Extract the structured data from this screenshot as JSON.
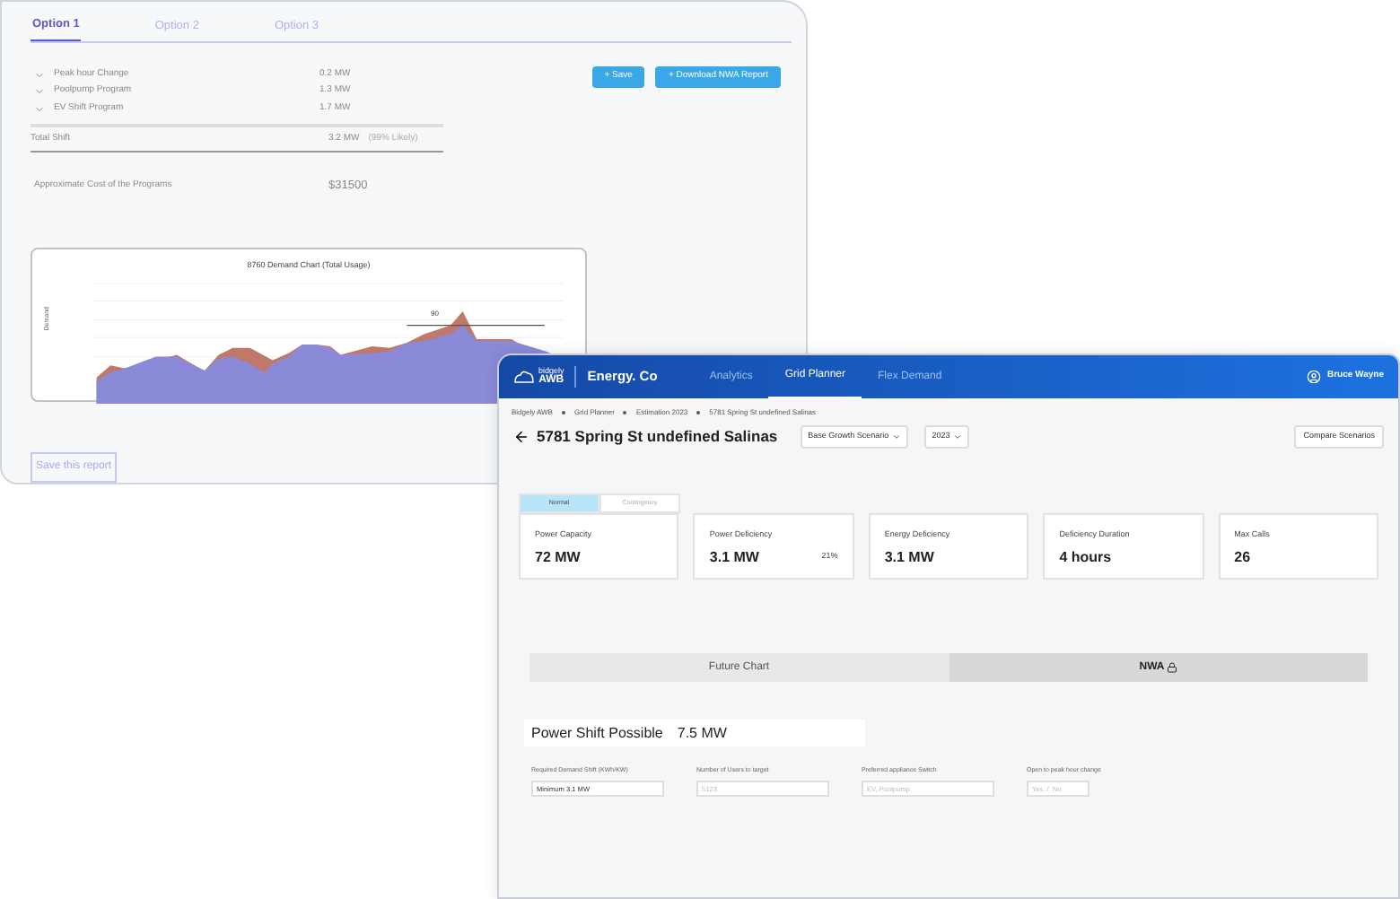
{
  "report_window": {
    "tabs": [
      {
        "label": "Option 1",
        "selected": true
      },
      {
        "label": "Option 2",
        "selected": false
      },
      {
        "label": "Option 3",
        "selected": false
      }
    ],
    "programs": [
      {
        "name": "Peak hour Change",
        "value": "0.2 MW",
        "expanded": false
      },
      {
        "name": "Poolpump Program",
        "value": "1.3 MW",
        "expanded": false
      },
      {
        "name": "EV Shift Program",
        "value": "1.7 MW",
        "expanded": false
      }
    ],
    "total": {
      "label": "Total Shift",
      "value": "3.2 MW",
      "note": "(99% Likely)"
    },
    "cost": {
      "label": "Approximate Cost of the Programs",
      "value": "$31500"
    },
    "buttons": [
      "+ Save",
      "+ Download NWA Report"
    ],
    "chart": {
      "title": "8760 Demand Chart (Total Usage)",
      "ylabel": "Demand",
      "peak_label": "90"
    },
    "save_link": "Save this report"
  },
  "app_window": {
    "logo": {
      "small": "bidgely",
      "big": "AWB"
    },
    "brand": "Energy. Co",
    "nav": [
      {
        "label": "Analytics",
        "selected": false
      },
      {
        "label": "Grid Planner",
        "selected": true
      },
      {
        "label": "Flex Demand",
        "selected": false
      }
    ],
    "user": "Bruce Wayne",
    "breadcrumb": [
      "Bidgely AWB",
      "Grid Planner",
      "Estimation 2023",
      "5781 Spring St undefined Salinas"
    ],
    "title": "5781 Spring St undefined Salinas",
    "dropdowns": [
      "Base Growth Scenario",
      "2023"
    ],
    "compare_button": "Compare Scenarios",
    "mode_toggle": [
      {
        "label": "Normal",
        "selected": true
      },
      {
        "label": "Contingency",
        "selected": false
      }
    ],
    "metrics": [
      {
        "label": "Power Capacity",
        "value": "72 MW"
      },
      {
        "label": "Power Deficiency",
        "value": "3.1 MW",
        "extra": "21%"
      },
      {
        "label": "Energy Deficiency",
        "value": "3.1 MW"
      },
      {
        "label": "Deficiency Duration",
        "value": "4 hours"
      },
      {
        "label": "Max Calls",
        "value": "26"
      }
    ],
    "view_tabs": [
      {
        "label": "Future Chart",
        "selected": false,
        "locked": false
      },
      {
        "label": "NWA",
        "selected": true,
        "locked": true
      }
    ],
    "power_shift": {
      "label": "Power Shift Possible",
      "value": "7.5 MW"
    },
    "fields": [
      {
        "label": "Required Demand Shift (KWh/KW)",
        "value": "Minimum 3.1 MW"
      },
      {
        "label": "Number of Users to target",
        "placeholder": "5123"
      },
      {
        "label": "Preferred appliance Switch",
        "placeholder": "EV, Poolpump"
      },
      {
        "label": "Open to peak hour change",
        "placeholder": "Yes  /  No",
        "kind": "short"
      }
    ]
  }
}
